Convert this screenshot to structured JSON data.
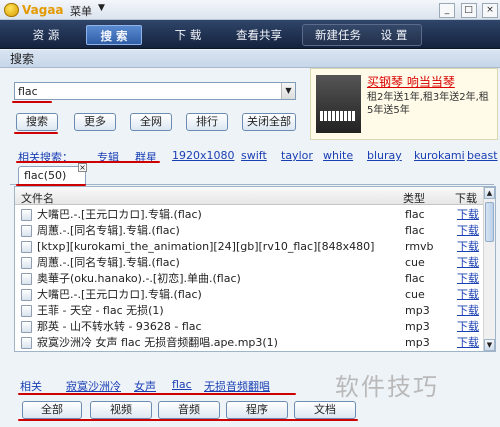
{
  "app": {
    "name": "Vagaa",
    "menu_label": "菜单",
    "menu_arrow": "▼"
  },
  "window_buttons": [
    "_",
    "□",
    "×"
  ],
  "nav": {
    "items": [
      "资 源",
      "搜 索",
      "下 载",
      "查看共享",
      "新建任务",
      "设 置"
    ],
    "active": "搜 索"
  },
  "search": {
    "section_title": "搜索",
    "query": "flac",
    "buttons": [
      "搜索",
      "更多",
      "全网",
      "排行",
      "关闭全部"
    ]
  },
  "ad": {
    "headline": "买钢琴 响当当琴",
    "body": "租2年送1年,租3年送2年,租5年送5年"
  },
  "related": {
    "label": "相关搜索：",
    "links": [
      "专辑",
      "群星",
      "1920x1080",
      "swift",
      "taylor",
      "white",
      "bluray",
      "kurokami",
      "beast"
    ]
  },
  "tab": {
    "label": "flac(50)",
    "close": "×"
  },
  "table": {
    "columns": [
      "文件名",
      "类型",
      "下载"
    ],
    "rows": [
      {
        "name": "大嘴巴.-.[王元口カロ].专辑.(flac)",
        "type": "flac",
        "dl": "下载"
      },
      {
        "name": "周蕙.-.[同名专辑].专辑.(flac)",
        "type": "flac",
        "dl": "下载"
      },
      {
        "name": "[ktxp][kurokami_the_animation][24][gb][rv10_flac][848x480]",
        "type": "rmvb",
        "dl": "下载"
      },
      {
        "name": "周蕙.-.[同名专辑].专辑.(flac)",
        "type": "cue",
        "dl": "下载"
      },
      {
        "name": "奥華子(oku.hanako).-.[初恋].单曲.(flac)",
        "type": "flac",
        "dl": "下载"
      },
      {
        "name": "大嘴巴.-.[王元口カロ].专辑.(flac)",
        "type": "cue",
        "dl": "下载"
      },
      {
        "name": "王菲 - 天空 - flac 无损(1)",
        "type": "mp3",
        "dl": "下载"
      },
      {
        "name": "那英 - 山不转水转 - 93628 - flac",
        "type": "mp3",
        "dl": "下载"
      },
      {
        "name": "寂寞沙洲冷 女声 flac 无损音频翻唱.ape.mp3(1)",
        "type": "mp3",
        "dl": "下载"
      }
    ]
  },
  "bottom": {
    "label": "相关",
    "links": [
      "寂寞沙洲冷",
      "女声",
      "flac",
      "无损音频翻唱"
    ],
    "categories": [
      "全部",
      "视频",
      "音频",
      "程序",
      "文档"
    ]
  },
  "watermark": "软件技巧",
  "colors": {
    "nav_bg": "#14223d",
    "link": "#1a3fb3",
    "annotation_red": "#cf0000"
  }
}
